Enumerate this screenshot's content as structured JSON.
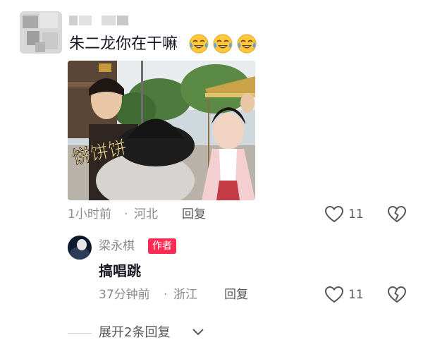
{
  "comment": {
    "text": "朱二龙你在干嘛",
    "emojis": [
      "laugh-cry-emoji",
      "laugh-cry-emoji",
      "laugh-cry-emoji"
    ],
    "photo_overlay_text": "饼饼饼",
    "time": "1小时前",
    "separator": "·",
    "location": "河北",
    "reply_label": "回复",
    "like_count": "11"
  },
  "reply": {
    "author": "梁永棋",
    "author_badge": "作者",
    "text": "搞唱跳",
    "time": "37分钟前",
    "separator": "·",
    "location": "浙江",
    "reply_label": "回复",
    "like_count": "11"
  },
  "expand": {
    "label": "展开2条回复"
  },
  "colors": {
    "badge": "#fe2c55",
    "text_primary": "#161823",
    "text_secondary": "#8a8a8f",
    "icon": "#57575c"
  }
}
